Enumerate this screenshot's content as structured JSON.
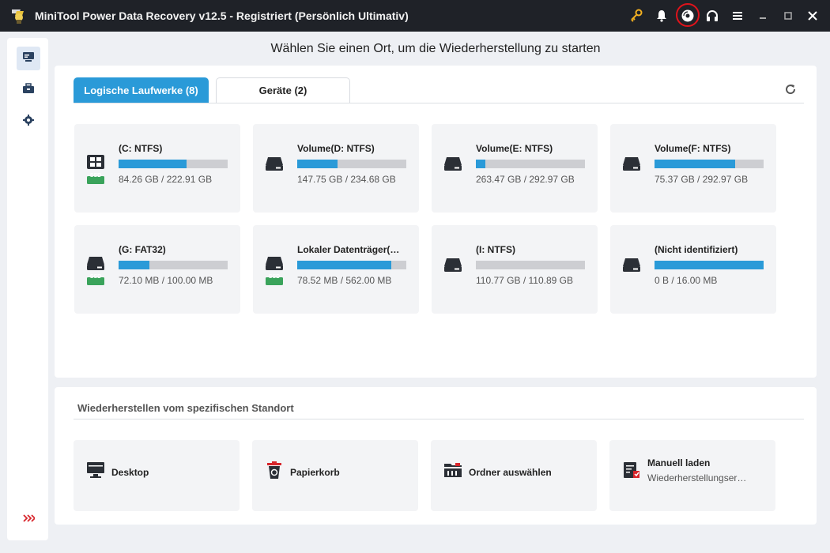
{
  "window": {
    "title": "MiniTool Power Data Recovery v12.5 - Registriert (Persönlich Ultimativ)",
    "icons": [
      "key-icon",
      "bell-icon",
      "disc-icon",
      "headset-icon",
      "menu-icon",
      "minimize-icon",
      "maximize-icon",
      "close-icon"
    ]
  },
  "sidebar": {
    "items": [
      "this-pc-icon",
      "toolbox-icon",
      "settings-icon"
    ],
    "expand": "expand-icon"
  },
  "main": {
    "heading": "Wählen Sie einen Ort, um die Wiederherstellung zu starten"
  },
  "tabs": {
    "logical": "Logische Laufwerke (8)",
    "devices": "Geräte (2)"
  },
  "drives": [
    {
      "name": "(C: NTFS)",
      "size": "84.26 GB / 222.91 GB",
      "used_fraction": 0.62,
      "ssd": true,
      "windows": true
    },
    {
      "name": "Volume(D: NTFS)",
      "size": "147.75 GB / 234.68 GB",
      "used_fraction": 0.37,
      "ssd": false,
      "windows": false
    },
    {
      "name": "Volume(E: NTFS)",
      "size": "263.47 GB / 292.97 GB",
      "used_fraction": 0.09,
      "ssd": false,
      "windows": false
    },
    {
      "name": "Volume(F: NTFS)",
      "size": "75.37 GB / 292.97 GB",
      "used_fraction": 0.74,
      "ssd": false,
      "windows": false
    },
    {
      "name": "(G: FAT32)",
      "size": "72.10 MB / 100.00 MB",
      "used_fraction": 0.28,
      "ssd": true,
      "windows": false
    },
    {
      "name": "Lokaler Datenträger(…",
      "size": "78.52 MB / 562.00 MB",
      "used_fraction": 0.86,
      "ssd": true,
      "windows": false
    },
    {
      "name": "(I: NTFS)",
      "size": "110.77 GB / 110.89 GB",
      "used_fraction": 0.0,
      "ssd": false,
      "windows": false
    },
    {
      "name": "(Nicht identifiziert)",
      "size": "0 B / 16.00 MB",
      "used_fraction": 1.0,
      "ssd": false,
      "windows": false
    }
  ],
  "ssd_badge": "SSD",
  "locations": {
    "heading": "Wiederherstellen vom spezifischen Standort",
    "items": [
      {
        "label": "Desktop",
        "icon": "desktop-icon"
      },
      {
        "label": "Papierkorb",
        "icon": "recycle-bin-icon"
      },
      {
        "label": "Ordner auswählen",
        "icon": "folder-icon"
      },
      {
        "label": "Manuell laden",
        "sub": "Wiederherstellungser…",
        "icon": "load-file-icon"
      }
    ]
  },
  "colors": {
    "accent": "#2a9ad8",
    "titlebar": "#1f2228",
    "ssd_green": "#3aa35b",
    "highlight": "#e0131b"
  }
}
